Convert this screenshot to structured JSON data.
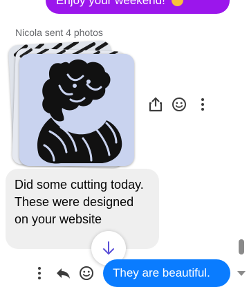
{
  "messages": {
    "top_outgoing": {
      "text": "Enjoy your weekend!"
    },
    "sender_line": "Nicola sent 4 photos",
    "incoming_text": "Did some cutting today. These were designed on your website",
    "outgoing_bottom": "They are beautiful."
  },
  "colors": {
    "purple_bubble": "#9b16ec",
    "blue_bubble": "#0a7cff",
    "gray_bubble": "#efefef",
    "icon": "#3c3c3c"
  },
  "icons": {
    "share": "share-icon",
    "react": "smiley-icon",
    "more": "more-vertical-icon",
    "reply": "reply-icon",
    "scroll_down": "arrow-down-icon"
  }
}
